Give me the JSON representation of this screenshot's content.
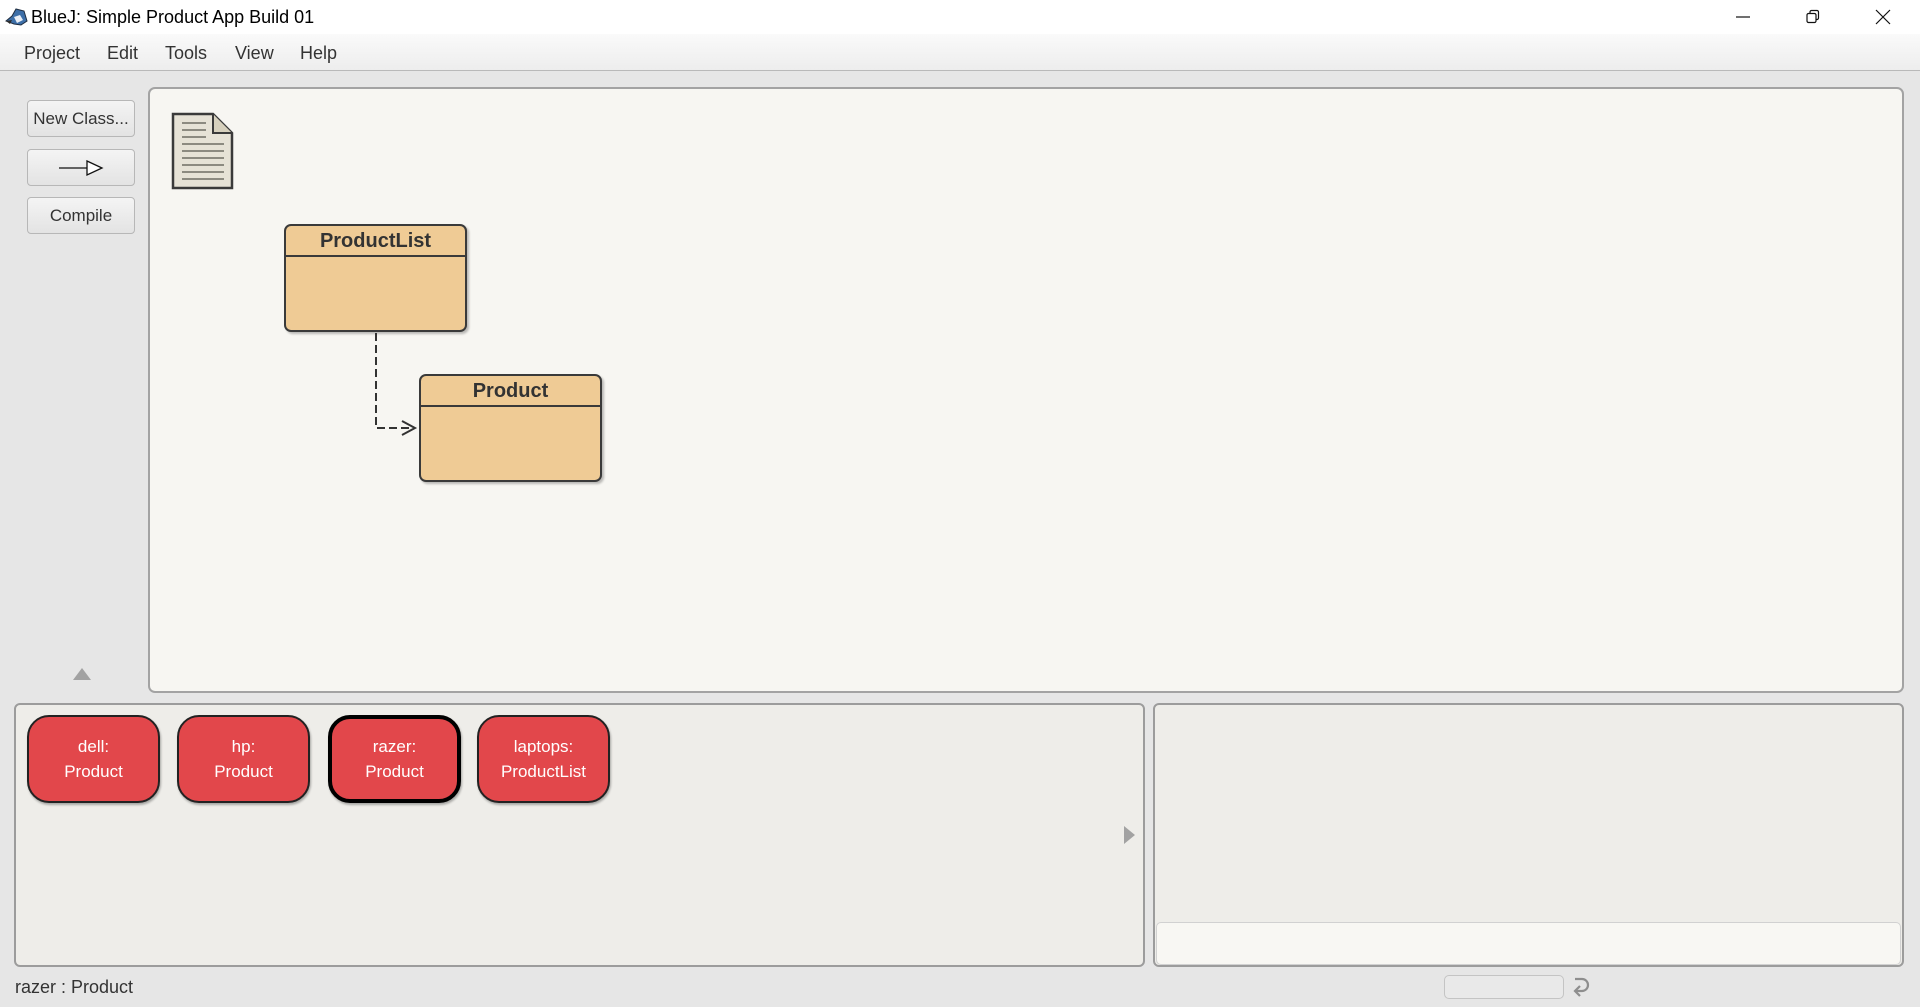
{
  "window": {
    "title": "BlueJ:  Simple Product App Build 01",
    "app_icon": "bluej-bird-icon",
    "controls": [
      "minimize-icon",
      "restore-icon",
      "close-icon"
    ]
  },
  "menu": {
    "items": [
      {
        "label": "Project"
      },
      {
        "label": "Edit"
      },
      {
        "label": "Tools"
      },
      {
        "label": "View"
      },
      {
        "label": "Help"
      }
    ]
  },
  "toolbar": {
    "new_class_label": "New Class...",
    "new_arrow_icon": "inheritance-arrow-icon",
    "compile_label": "Compile"
  },
  "diagram": {
    "readme_icon": "readme-document-icon",
    "classes": [
      {
        "name": "ProductList",
        "color": "#efcb95"
      },
      {
        "name": "Product",
        "color": "#efcb95"
      }
    ],
    "dependencies": [
      {
        "from": "ProductList",
        "to": "Product",
        "style": "dashed"
      }
    ]
  },
  "object_bench": {
    "color": "#e2474b",
    "objects": [
      {
        "name": "dell:",
        "type": "Product",
        "selected": false
      },
      {
        "name": "hp:",
        "type": "Product",
        "selected": false
      },
      {
        "name": "razer:",
        "type": "Product",
        "selected": true
      },
      {
        "name": "laptops:",
        "type": "ProductList",
        "selected": false
      }
    ]
  },
  "codepad": {
    "input_value": ""
  },
  "status": {
    "text": "razer : Product"
  }
}
